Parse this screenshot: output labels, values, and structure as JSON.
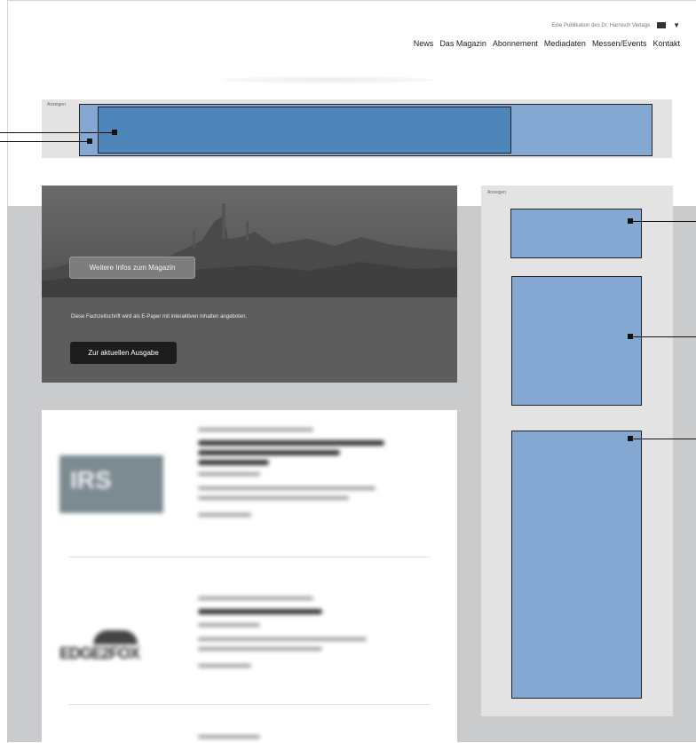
{
  "header": {
    "publisher_note": "Eine Publikation des Dr. Harnisch Verlags",
    "nav": [
      "News",
      "Das Magazin",
      "Abonnement",
      "Mediadaten",
      "Messen/Events",
      "Kontakt"
    ]
  },
  "ads": {
    "label": "Anzeigen"
  },
  "hero": {
    "more_info_button": "Weitere Infos zum Magazin",
    "description": "Diese Fachzeitschrift wird als E-Paper mit interaktiven Inhalten angeboten.",
    "current_issue_button": "Zur aktuellen Ausgabe"
  },
  "icons": {
    "language_flag": "flag-icon",
    "dropdown": "chevron-down-icon"
  },
  "colors": {
    "ad_light": "#85a8d2",
    "ad_dark": "#4e86bc",
    "ad_frame": "#e3e3e3",
    "page_bg_lower": "#c9cbcd"
  }
}
